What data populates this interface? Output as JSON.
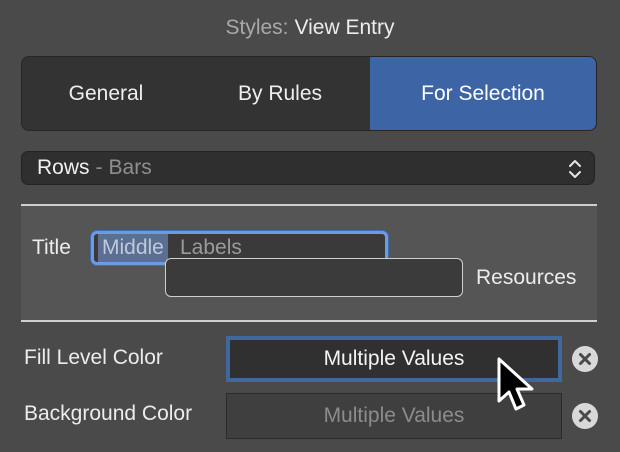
{
  "header": {
    "prefix": "Styles:",
    "title": "View Entry"
  },
  "tabs": [
    {
      "label": "General",
      "selected": false
    },
    {
      "label": "By Rules",
      "selected": false
    },
    {
      "label": "For Selection",
      "selected": true
    }
  ],
  "entry_popup": {
    "primary": "Rows",
    "separator": "-",
    "secondary": "Bars",
    "icon": "chevron-up-down-icon"
  },
  "title_row": {
    "label": "Title",
    "value_selected": "Middle",
    "value_rest": "Labels",
    "resources_label": "Resources"
  },
  "fill_level_color": {
    "label": "Fill Level Color",
    "value": "Multiple Values",
    "clear_icon": "clear-circle-x-icon"
  },
  "background_color": {
    "label": "Background Color",
    "value": "Multiple Values",
    "clear_icon": "clear-circle-x-icon"
  },
  "colors": {
    "accent": "#3d65a6",
    "focus_ring": "#6d9be0",
    "background": "#4a4a4a"
  },
  "cursor_icon": "arrow-pointer-icon"
}
